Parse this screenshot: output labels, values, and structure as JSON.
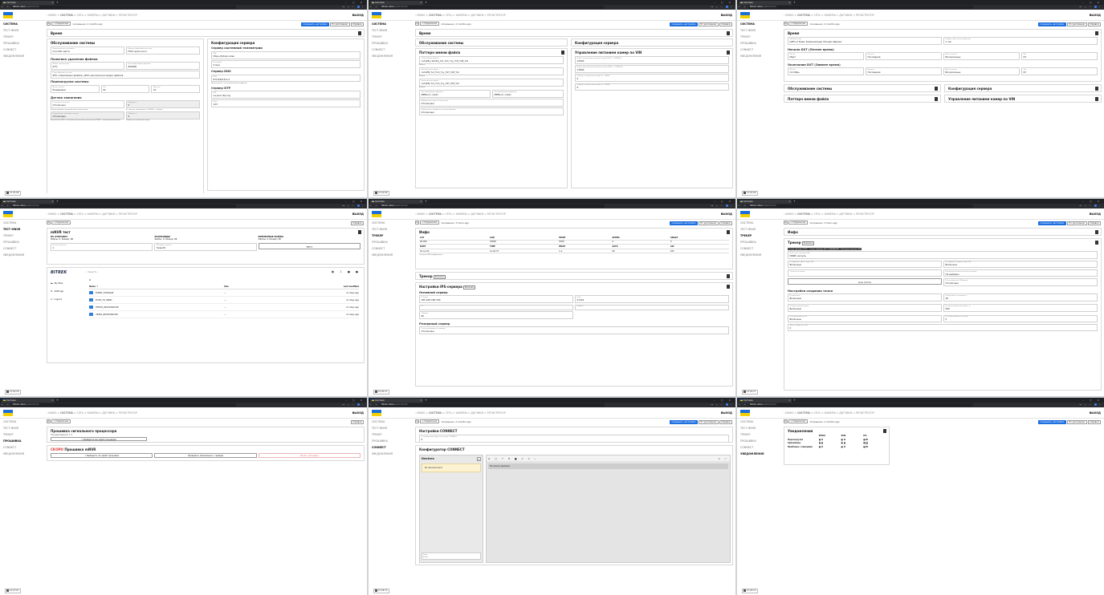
{
  "tab_title": "Система",
  "url_domain": "bitrek.video",
  "url_path": "/system/main",
  "exit_label": "ВЫХОД",
  "sidebar": [
    "СИСТЕМА",
    "ТЕСТ MNVR",
    "ТРЕКЕР",
    "ПРОШИВКА",
    "CONNECT",
    "УВЕДОМЛЕНИЯ"
  ],
  "crumbs": [
    "ИНФО",
    "СИСТЕМА",
    "СЕТЬ",
    "КАМЕРЫ",
    "ДАТЧИКИ",
    "РЕГИСТРАТОР"
  ],
  "toolbar": {
    "back": "Подключил",
    "save": "Сохранить настройки",
    "reset": "По умолчанию",
    "help": "Справка"
  },
  "saved_months": "Сохранено: 2 months ago",
  "saved_hours": "Сохранено: 3 hours ago",
  "status_times": [
    "13:20:08",
    "13:20:08",
    "13:20:08",
    "13:20:18",
    "13:20:17",
    "13:20:17",
    "13:27:07",
    "13:28:13",
    "13:29:13"
  ],
  "p1": {
    "time": "Время",
    "maint": "Обслуживание системы",
    "dev_label": "Производство установки",
    "dev_val": "microSD карта",
    "fs_label": "Формат файловой системы",
    "fs_val": "FAT4 (для Linux)",
    "del_policy": "Политика удаления файлов",
    "lim_label": "Лимит заполнения",
    "lim_val": "97%",
    "old_label": "К-во событийных файлов",
    "old_val": "600000",
    "save_label": "Сохр. файлов по типу",
    "save_val": "20% событийных файлов | 80% циклических видео файлов",
    "reboot": "Перезагрузка системы",
    "day_label": "День недели",
    "day_val": "Ежедневно",
    "hr_label": "Час",
    "hr_val": "02",
    "min_label": "Минуты",
    "min_val": "01",
    "ign": "Датчик зажигания",
    "ign_state_l": "Состояние датчика",
    "ign_state_v": "Отключено",
    "ign_timeout_l": "Таймаут, с",
    "ign_timeout_v": "0",
    "ign_note1": "Использование входа датчика зажигания",
    "ign_note2": "В - датчик зажигания, 1-20000с - таймер",
    "ign_off_l": "Управление питанием камер",
    "ign_off_v": "Отключено",
    "ign_off2_l": "Таймаут, с",
    "ign_off2_v": "0",
    "ign_note3": "Включение MVR - питанию включению, включение MVR1 - камеры выключение",
    "ign_note4": "Таймер отключения камер",
    "srv": "Конфигурация сервера",
    "telem": "Сервер системной телеметрии",
    "telem_url_l": "URL",
    "telem_url_v": "https://bitrek.video",
    "telem_int_l": "Интервал",
    "telem_int_v": "5 мин",
    "dns": "Сервер DNS",
    "dns_l": "DNS",
    "dns_v": "8.8.8.8/8.8.4.4",
    "dns_note": "Используйте / для разделения серверов",
    "ntp": "Сервер NTP",
    "ntp_url_l": "URL",
    "ntp_url_v": "ua.pool.ntp.org",
    "ntp_port_l": "Порт",
    "ntp_port_v": "123"
  },
  "p2": {
    "time": "Время",
    "maint": "Обслуживание системы",
    "srv": "Конфигурация сервера",
    "pattern": "Паттерн имени файла",
    "pf": [
      {
        "l": "Событийные файлы",
        "v": "cam#N_cam#q_%d_%m_%y_%H_%M_%S"
      },
      {
        "l": "Циклические видео",
        "v": "cam#N_%d_%m_%y_%H_%M_%S"
      },
      {
        "l": "Циклические видео",
        "v": "cam#N_%d_%m_%y_%H_%M_%S"
      }
    ],
    "pf_note": "Важно",
    "ev_type_l": "Тип событийных файлов",
    "ev_type_v": "MPEG-4 (.mp4)",
    "cyc_type_l": "Тип циклических файлов",
    "cyc_type_v": "MPEG-4 (.mp4)",
    "add_date_l": "Добавление даты в имя папки",
    "add_date_v": "Отключено",
    "add_pref_l": "Добавление префикса в имени файлов",
    "add_pref_v": "Отключено",
    "vin": "Управление питанием камер по VIN",
    "vin_f": [
      {
        "l": "Порог включения питания камер (В/10) - 120В/100",
        "v": "12000"
      },
      {
        "l": "Порог выключения питания камер (В/10) - 120В/100",
        "v": "11800"
      },
      {
        "l": "Таймер отключения камер (с) - 3600с",
        "v": "0"
      },
      {
        "l": "Таймер отключения камер (с) - 3600с",
        "v": "0"
      }
    ]
  },
  "p3": {
    "time": "Время",
    "tz_l": "Часовой пояс",
    "tz_v": "GMT+2 Киев, Калининград, Южная Африка",
    "dst_shift_l": "Подвиг при летнем времени",
    "dst_shift_v": "1 час",
    "dst_start": "Начало DST (Летнее время)",
    "start": [
      {
        "l": "Месяц",
        "v": "Март"
      },
      {
        "l": "Неделя",
        "v": "Последняя"
      },
      {
        "l": "День недели",
        "v": "Воскресенье"
      },
      {
        "l": "Час",
        "v": "03"
      }
    ],
    "dst_end": "Окончание DST (Зимнее время)",
    "end": [
      {
        "l": "Месяц",
        "v": "Октябрь"
      },
      {
        "l": "Неделя",
        "v": "Последняя"
      },
      {
        "l": "День недели",
        "v": "Воскресенье"
      },
      {
        "l": "Час",
        "v": "03"
      }
    ],
    "maint": "Обслуживание системы",
    "srv": "Конфигурация сервера",
    "pattern": "Паттерн имени файла",
    "vin": "Управление питанием камер по VIN"
  },
  "p4": {
    "title": "mNVR тест",
    "col1": "НА ОТПРАВКУ",
    "col1v": "Файлы: 0, Размер: 0B",
    "col2": "ХРАНИЛИЩЕ",
    "col2v": "Файлы: 0, Размер: 0B",
    "col3": "ВРЕМЕННЫЕ ФАЙЛЫ",
    "col3v": "Файлы: 0, Размер: 0B",
    "f1l": "Кол-во записей",
    "f1v": "1",
    "f2l": "Интервал записи",
    "f2v": "5мин(8)",
    "test": "ТЕСТ",
    "fm_logo": "BITREK",
    "fm_search": "Search...",
    "fm_menu": [
      "My files",
      "Settings",
      "Logout"
    ],
    "fm_cols": [
      "Name ↑",
      "Size",
      "Last modified"
    ],
    "fm_rows": [
      {
        "n": "EVENT_STORAGE",
        "s": "—",
        "m": "11 days ago"
      },
      {
        "n": "FILES_TO_SEND",
        "s": "—",
        "m": "11 days ago"
      },
      {
        "n": "PHOTO_REGISTRATOR",
        "s": "—",
        "m": "11 days ago"
      },
      {
        "n": "VIDEO_REGISTRATOR",
        "s": "—",
        "m": "11 days ago"
      }
    ]
  },
  "p5": {
    "info": "Инфо",
    "h1": [
      "LAT",
      "LON",
      "MOVE",
      "SPEED",
      "ANGLE"
    ],
    "r1": [
      "90.000",
      "70656",
      "STOP",
      "0",
      "0"
    ],
    "h2": [
      "DATE",
      "TIME",
      "HDOP",
      "SATS",
      "ALT"
    ],
    "r2": [
      "01-11-22",
      "11:20:37",
      "1.4",
      "06",
      "165"
    ],
    "gps_note": "Текущая GPS информация",
    "tracker": "Трекер",
    "enabled": "Включено",
    "ips": "Настройки IPS-сервера",
    "main_srv": "Основной сервер",
    "addr_l": "IP адрес",
    "addr_v": "185.180.180.180",
    "port_l": "Порт",
    "port_v": "21441",
    "id_l": "ID",
    "pass_l": "Пароль",
    "to_l": "Таймаут",
    "to_v": "60",
    "reserve": "Резервный сервер",
    "res_l": "Статус резервного сервера",
    "res_v": "Отключено"
  },
  "p6": {
    "info": "Инфо",
    "tracker": "Трекер",
    "enabled": "Включено",
    "tags": [
      "Статус трекера: ОТКЛ.",
      "Статус сервера: НЕТ СОЕДИНЕНИЯ",
      "Последние данные: НЕТ"
    ],
    "imei_l": "Флаг для отправки IPS",
    "imei_v": "DRKB vесхуль",
    "a_l": "Отправлять фото через IPS",
    "a_v": "Включено",
    "b_l": "Отправлять группу через IPS",
    "b_v": "Включено",
    "c_l": "Ссылка на камер",
    "d_l": "Предпочтительно ссылка на камер",
    "d_v": "Не выбрано",
    "live": "Live поток",
    "e_l": "Постановление ПЛ-видео",
    "e_v": "Отключено",
    "point": "Настройки создания точки",
    "pt": [
      {
        "l": "По времени",
        "v": "Включено"
      },
      {
        "l": "По времени, интервал, с",
        "v": "30"
      },
      {
        "l": "По расстоянию вдоль",
        "v": "Включено"
      },
      {
        "l": "По расстоянию, интервал, м",
        "v": "500"
      },
      {
        "l": "По изменению угла",
        "v": "Включено"
      },
      {
        "l": "По изменению угла, град",
        "v": "5"
      }
    ],
    "last_l": "Макс. скорость, км/ч",
    "last_v": "0"
  },
  "p7": {
    "fw_title": "Прошивка сигнального процессора",
    "fw_ver": "Текущая версия: 1.3",
    "fw_btn": "Выберите bin-файл прошивки",
    "soon": "СКОРО",
    "mnvr": "Прошивка mNVR",
    "b1": "Выберите .bin файл прошивки",
    "b2": "Проверить обновление с сервера",
    "b3": "Начать прошивку"
  },
  "p8": {
    "cs": "Настройки CONNECT",
    "cs_l": "Оптимальный адрес на основе CONNECT",
    "cs_v": "0",
    "conf": "Конфигуратор CONNECT",
    "devices": "Devices",
    "nodev": "No devices found",
    "nosel": "No device selected",
    "trace_l": "Трасс",
    "trace_v": "••••"
  },
  "p9": {
    "title": "Уведомления",
    "cols": [
      "EMAIL",
      "SMS",
      "IPC"
    ],
    "rows": [
      "Перезагрузка",
      "Хранилище",
      "Проблема с камерами"
    ]
  }
}
